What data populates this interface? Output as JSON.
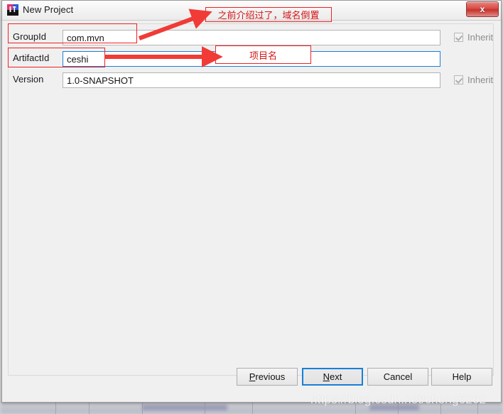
{
  "window": {
    "title": "New Project",
    "icon": "intellij-idea-icon",
    "close_label": "x"
  },
  "form": {
    "fields": [
      {
        "label": "GroupId",
        "value": "com.mvn",
        "focused": false,
        "inherit": true,
        "inherit_label": "Inherit"
      },
      {
        "label": "ArtifactId",
        "value": "ceshi",
        "focused": true,
        "inherit": false,
        "inherit_label": ""
      },
      {
        "label": "Version",
        "value": "1.0-SNAPSHOT",
        "focused": false,
        "inherit": true,
        "inherit_label": "Inherit"
      }
    ]
  },
  "buttons": {
    "previous": {
      "pre": "P",
      "mnemonic": "",
      "post": "revious",
      "label": "Previous"
    },
    "next": {
      "pre": "",
      "mnemonic": "N",
      "post": "ext",
      "label": "Next"
    },
    "cancel": {
      "label": "Cancel"
    },
    "help": {
      "label": "Help"
    }
  },
  "annotations": {
    "note_groupid": "之前介绍过了，域名倒置",
    "note_artifactid": "项目名",
    "color": "#ee2222"
  },
  "watermark": "https://blog.csdn.net/cheng6262"
}
